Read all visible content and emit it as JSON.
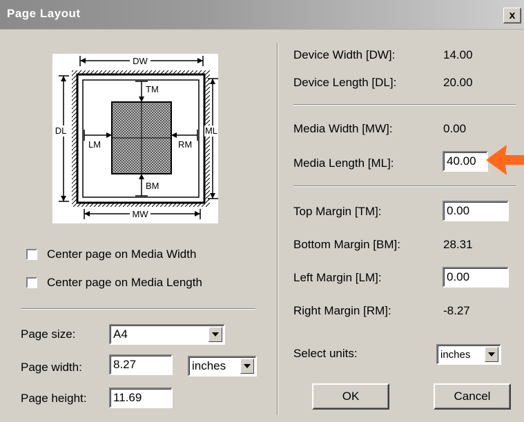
{
  "window": {
    "title": "Page Layout",
    "close_label": "x"
  },
  "diagram": {
    "dw": "DW",
    "dl": "DL",
    "ml": "ML",
    "mw": "MW",
    "tm": "TM",
    "bm": "BM",
    "lm": "LM",
    "rm": "RM"
  },
  "left": {
    "center_width_label": "Center page on Media Width",
    "center_length_label": "Center page on Media Length",
    "page_size_label": "Page size:",
    "page_size_value": "A4",
    "page_width_label": "Page width:",
    "page_width_value": "8.27",
    "width_units_value": "inches",
    "page_height_label": "Page height:",
    "page_height_value": "11.69"
  },
  "right": {
    "device_width_label": "Device Width [DW]:",
    "device_width_value": "14.00",
    "device_length_label": "Device Length [DL]:",
    "device_length_value": "20.00",
    "media_width_label": "Media Width [MW]:",
    "media_width_value": "0.00",
    "media_length_label": "Media Length [ML]:",
    "media_length_value": "40.00",
    "top_margin_label": "Top Margin [TM]:",
    "top_margin_value": "0.00",
    "bottom_margin_label": "Bottom Margin [BM]:",
    "bottom_margin_value": "28.31",
    "left_margin_label": "Left Margin [LM]:",
    "left_margin_value": "0.00",
    "right_margin_label": "Right Margin [RM]:",
    "right_margin_value": "-8.27",
    "select_units_label": "Select units:",
    "select_units_value": "inches"
  },
  "buttons": {
    "ok": "OK",
    "cancel": "Cancel"
  },
  "colors": {
    "annotation_arrow": "#ff6a1a"
  }
}
